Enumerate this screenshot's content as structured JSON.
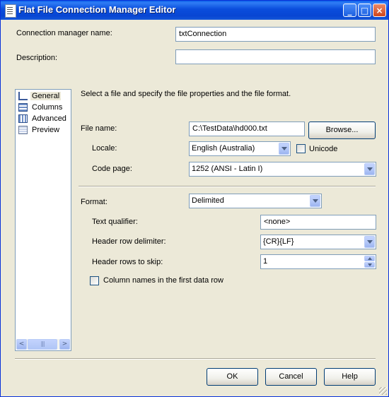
{
  "window": {
    "title": "Flat File Connection Manager Editor",
    "minimize_glyph": "_",
    "maximize_glyph": "□",
    "close_glyph": "×"
  },
  "connection_name": {
    "label": "Connection manager name:",
    "value": "txtConnection"
  },
  "description": {
    "label": "Description:",
    "value": ""
  },
  "nav": {
    "items": [
      {
        "label": "General",
        "icon": "general-icon",
        "selected": true
      },
      {
        "label": "Columns",
        "icon": "columns-icon"
      },
      {
        "label": "Advanced",
        "icon": "advanced-icon"
      },
      {
        "label": "Preview",
        "icon": "preview-icon"
      }
    ],
    "scroll_left": "<",
    "scroll_right": ">",
    "scroll_grip": "|||"
  },
  "general": {
    "instructions": "Select a file and specify the file properties and the file format.",
    "file_name": {
      "label": "File name:",
      "value": "C:\\TestData\\hd000.txt"
    },
    "browse_label": "Browse...",
    "locale": {
      "label": "Locale:",
      "value": "English (Australia)"
    },
    "unicode_label": "Unicode",
    "code_page": {
      "label": "Code page:",
      "value": "1252  (ANSI - Latin I)"
    },
    "format": {
      "label": "Format:",
      "value": "Delimited"
    },
    "text_qualifier": {
      "label": "Text qualifier:",
      "value": "<none>"
    },
    "header_row_delimiter": {
      "label": "Header row delimiter:",
      "value": "{CR}{LF}"
    },
    "header_rows_to_skip": {
      "label": "Header rows to skip:",
      "value": "1"
    },
    "column_names_label": "Column names in the first data row"
  },
  "footer": {
    "ok_label": "OK",
    "cancel_label": "Cancel",
    "help_label": "Help"
  },
  "colors": {
    "titlebar": "#0a4ddc",
    "dialog_bg": "#ece9d8",
    "field_border": "#7f9db9"
  }
}
